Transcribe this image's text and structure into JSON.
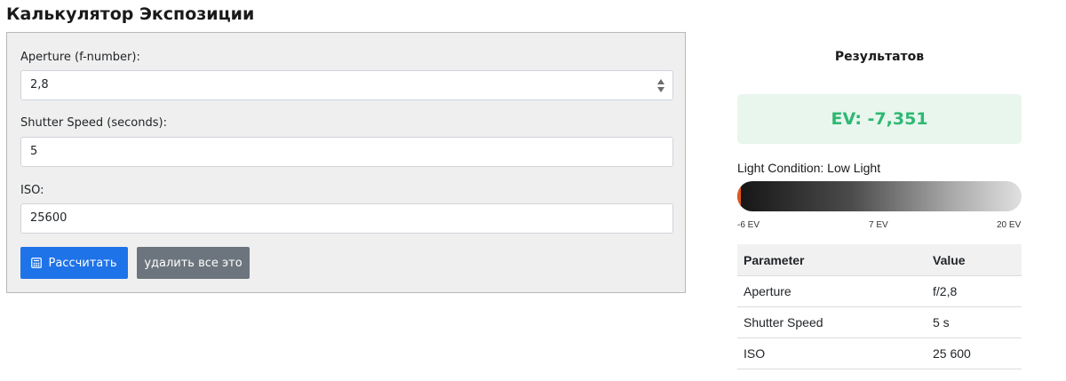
{
  "page": {
    "title": "Калькулятор Экспозиции"
  },
  "form": {
    "aperture": {
      "label": "Aperture (f-number):",
      "value": "2,8"
    },
    "shutter": {
      "label": "Shutter Speed (seconds):",
      "value": "5"
    },
    "iso": {
      "label": "ISO:",
      "value": "25600"
    },
    "buttons": {
      "calculate": "Рассчитать",
      "clear": "удалить все это"
    }
  },
  "results": {
    "title": "Результатов",
    "ev_text": "EV: -7,351",
    "light_condition": "Light Condition: Low Light",
    "light_scale": {
      "min_label": "-6 EV",
      "mid_label": "7 EV",
      "max_label": "20 EV",
      "min": -6,
      "max": 20,
      "marker_value": -6
    },
    "table": {
      "headers": [
        "Parameter",
        "Value"
      ],
      "rows": [
        {
          "param": "Aperture",
          "value": "f/2,8"
        },
        {
          "param": "Shutter Speed",
          "value": "5 s"
        },
        {
          "param": "ISO",
          "value": "25 600"
        }
      ]
    }
  },
  "colors": {
    "primary_button": "#1e73e8",
    "secondary_button": "#6c757d",
    "ev_text": "#2eb872",
    "ev_background": "#e8f6ee",
    "marker": "#e25a1c"
  },
  "icons": {
    "calculate_button_icon": "calculator-icon",
    "number_spinner": "spinner-arrows-icon"
  }
}
